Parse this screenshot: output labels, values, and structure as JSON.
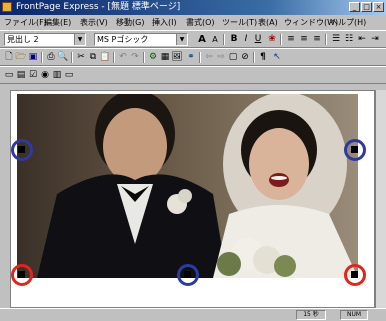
{
  "window": {
    "title": "FrontPage Express - [無題 標準ページ]",
    "controls": [
      "_",
      "□",
      "×"
    ]
  },
  "menu": [
    "ファイル(F)",
    "編集(E)",
    "表示(V)",
    "移動(G)",
    "挿入(I)",
    "書式(O)",
    "ツール(T)",
    "表(A)",
    "ウィンドウ(W)",
    "ヘルプ(H)"
  ],
  "format_toolbar": {
    "style_value": "見出し 2",
    "font_value": "MS Pゴシック",
    "font_size_up": "A",
    "font_size_down": "A",
    "bold": "B",
    "italic": "I",
    "underline": "U"
  },
  "status": {
    "time": "15 秒",
    "num": "NUM"
  },
  "colors": {
    "titlebar": "#0a246a",
    "ring_blue": "#2e3b9e",
    "ring_red": "#e0261c"
  },
  "handles": {
    "blue_rings": [
      "top-left",
      "top-right",
      "bottom-center"
    ],
    "red_rings": [
      "bottom-left",
      "bottom-right"
    ]
  }
}
